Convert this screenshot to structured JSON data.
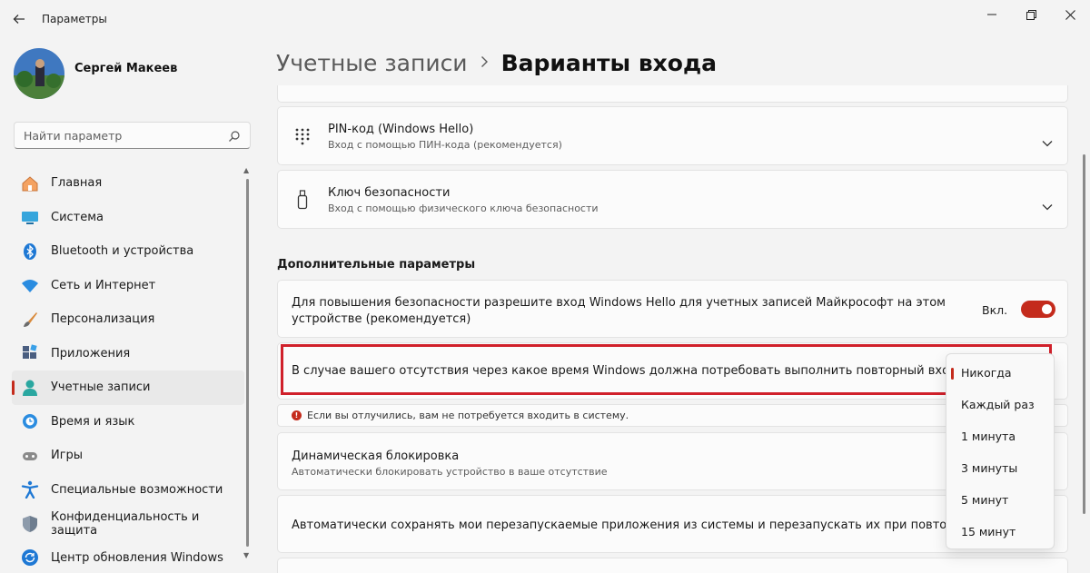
{
  "window": {
    "title": "Параметры"
  },
  "user": {
    "name": "Сергей Макеев"
  },
  "search": {
    "placeholder": "Найти параметр"
  },
  "sidebar": {
    "items": [
      {
        "label": "Главная",
        "icon": "home-icon"
      },
      {
        "label": "Система",
        "icon": "system-icon"
      },
      {
        "label": "Bluetooth и устройства",
        "icon": "bluetooth-icon"
      },
      {
        "label": "Сеть и Интернет",
        "icon": "wifi-icon"
      },
      {
        "label": "Персонализация",
        "icon": "brush-icon"
      },
      {
        "label": "Приложения",
        "icon": "apps-icon"
      },
      {
        "label": "Учетные записи",
        "icon": "accounts-icon",
        "active": true
      },
      {
        "label": "Время и язык",
        "icon": "time-language-icon"
      },
      {
        "label": "Игры",
        "icon": "gamepad-icon"
      },
      {
        "label": "Специальные возможности",
        "icon": "accessibility-icon"
      },
      {
        "label": "Конфиденциальность и защита",
        "icon": "shield-icon"
      },
      {
        "label": "Центр обновления Windows",
        "icon": "update-icon"
      }
    ]
  },
  "breadcrumb": {
    "parent": "Учетные записи",
    "current": "Варианты входа"
  },
  "sign_in_options": [
    {
      "title": "PIN-код (Windows Hello)",
      "subtitle": "Вход с помощью ПИН-кода (рекомендуется)",
      "icon": "pin-keypad-icon"
    },
    {
      "title": "Ключ безопасности",
      "subtitle": "Вход с помощью физического ключа безопасности",
      "icon": "security-key-icon"
    }
  ],
  "additional": {
    "heading": "Дополнительные параметры",
    "hello_only": {
      "text": "Для повышения безопасности разрешите вход Windows Hello для учетных записей Майкрософт на этом устройстве (рекомендуется)",
      "toggle_label": "Вкл.",
      "toggle_on": true
    },
    "require_signin": {
      "question": "В случае вашего отсутствия через какое время Windows должна потребовать выполнить повторный вход?",
      "options": [
        "Никогда",
        "Каждый раз",
        "1 минута",
        "3 минуты",
        "5 минут",
        "15 минут"
      ],
      "selected": "Никогда",
      "info": "Если вы отлучились, вам не потребуется входить в систему."
    },
    "dynamic_lock": {
      "title": "Динамическая блокировка",
      "subtitle": "Автоматически блокировать устройство в ваше отсутствие"
    },
    "restart_apps": {
      "text": "Автоматически сохранять мои перезапускаемые приложения из системы и перезапускать их при повторном входе"
    }
  },
  "colors": {
    "accent": "#c42b1c",
    "highlight_border": "#d0202a"
  }
}
